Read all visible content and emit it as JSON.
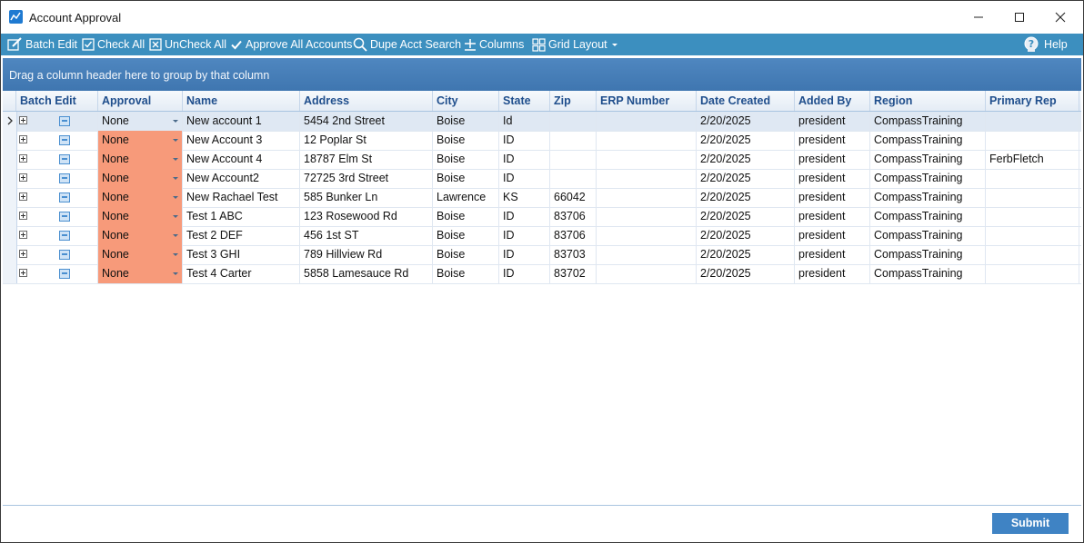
{
  "window": {
    "title": "Account Approval",
    "controls": [
      "minimize",
      "maximize",
      "close"
    ]
  },
  "toolbar": {
    "batch_edit": "Batch Edit",
    "check_all": "Check All",
    "uncheck_all": "UnCheck All",
    "approve_all": "Approve All Accounts",
    "dupe_search": "Dupe Acct Search",
    "columns": "Columns",
    "grid_layout": "Grid Layout",
    "help": "Help"
  },
  "grid": {
    "group_panel_text": "Drag a column header here to group by that column",
    "columns": [
      "Batch Edit",
      "Approval",
      "Name",
      "Address",
      "City",
      "State",
      "Zip",
      "ERP Number",
      "Date Created",
      "Added By",
      "Region",
      "Primary Rep"
    ],
    "rows": [
      {
        "approval": "None",
        "name": "New account 1",
        "address": "5454 2nd Street",
        "city": "Boise",
        "state": "Id",
        "zip": "",
        "erp": "",
        "date": "2/20/2025",
        "added_by": "president",
        "region": "CompassTraining",
        "rep": "",
        "selected": true,
        "highlight": false
      },
      {
        "approval": "None",
        "name": "New Account 3",
        "address": "12 Poplar St",
        "city": "Boise",
        "state": "ID",
        "zip": "",
        "erp": "",
        "date": "2/20/2025",
        "added_by": "president",
        "region": "CompassTraining",
        "rep": "",
        "selected": false,
        "highlight": true
      },
      {
        "approval": "None",
        "name": "New Account 4",
        "address": "18787 Elm St",
        "city": "Boise",
        "state": "ID",
        "zip": "",
        "erp": "",
        "date": "2/20/2025",
        "added_by": "president",
        "region": "CompassTraining",
        "rep": "FerbFletch",
        "selected": false,
        "highlight": true
      },
      {
        "approval": "None",
        "name": "New Account2",
        "address": "72725 3rd Street",
        "city": "Boise",
        "state": "ID",
        "zip": "",
        "erp": "",
        "date": "2/20/2025",
        "added_by": "president",
        "region": "CompassTraining",
        "rep": "",
        "selected": false,
        "highlight": true
      },
      {
        "approval": "None",
        "name": "New Rachael Test",
        "address": "585 Bunker Ln",
        "city": "Lawrence",
        "state": "KS",
        "zip": "66042",
        "erp": "",
        "date": "2/20/2025",
        "added_by": "president",
        "region": "CompassTraining",
        "rep": "",
        "selected": false,
        "highlight": true
      },
      {
        "approval": "None",
        "name": "Test 1 ABC",
        "address": "123 Rosewood Rd",
        "city": "Boise",
        "state": "ID",
        "zip": "83706",
        "erp": "",
        "date": "2/20/2025",
        "added_by": "president",
        "region": "CompassTraining",
        "rep": "",
        "selected": false,
        "highlight": true
      },
      {
        "approval": "None",
        "name": "Test 2 DEF",
        "address": "456 1st ST",
        "city": "Boise",
        "state": "ID",
        "zip": "83706",
        "erp": "",
        "date": "2/20/2025",
        "added_by": "president",
        "region": "CompassTraining",
        "rep": "",
        "selected": false,
        "highlight": true
      },
      {
        "approval": "None",
        "name": "Test 3 GHI",
        "address": "789 Hillview Rd",
        "city": "Boise",
        "state": "ID",
        "zip": "83703",
        "erp": "",
        "date": "2/20/2025",
        "added_by": "president",
        "region": "CompassTraining",
        "rep": "",
        "selected": false,
        "highlight": true
      },
      {
        "approval": "None",
        "name": "Test 4 Carter",
        "address": "5858 Lamesauce Rd",
        "city": "Boise",
        "state": "ID",
        "zip": "83702",
        "erp": "",
        "date": "2/20/2025",
        "added_by": "president",
        "region": "CompassTraining",
        "rep": "",
        "selected": false,
        "highlight": true
      }
    ]
  },
  "footer": {
    "submit_label": "Submit"
  },
  "colors": {
    "toolbar": "#3c8fbf",
    "header_text": "#1f4e8c",
    "approval_highlight": "#f79a7a",
    "submit": "#3f83c4"
  }
}
